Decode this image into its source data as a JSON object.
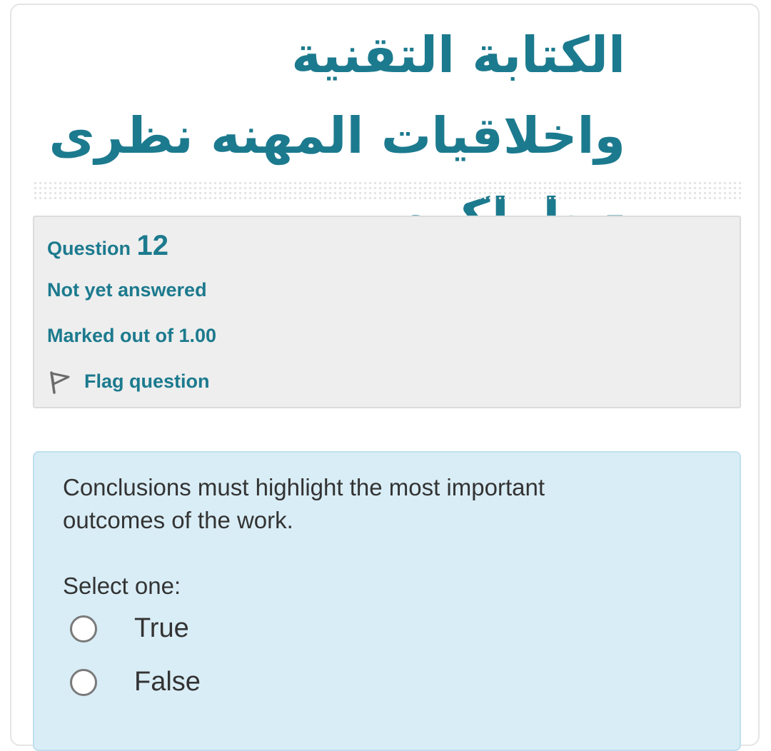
{
  "course": {
    "title": "الكتابة التقنية واخلاقيات المهنه نظرى - طولكرم"
  },
  "question_info": {
    "label": "Question",
    "number": "12",
    "status": "Not yet answered",
    "marks": "Marked out of 1.00",
    "flag_label": "Flag question"
  },
  "question": {
    "text": "Conclusions must highlight the most important outcomes of the work.",
    "prompt": "Select one:",
    "options": [
      {
        "label": "True",
        "selected": false
      },
      {
        "label": "False",
        "selected": false
      }
    ]
  },
  "colors": {
    "accent": "#1c7a8e",
    "info_bg": "#eeeeee",
    "question_bg": "#d9edf6",
    "text": "#333333"
  },
  "icons": {
    "flag": "flag-icon"
  }
}
